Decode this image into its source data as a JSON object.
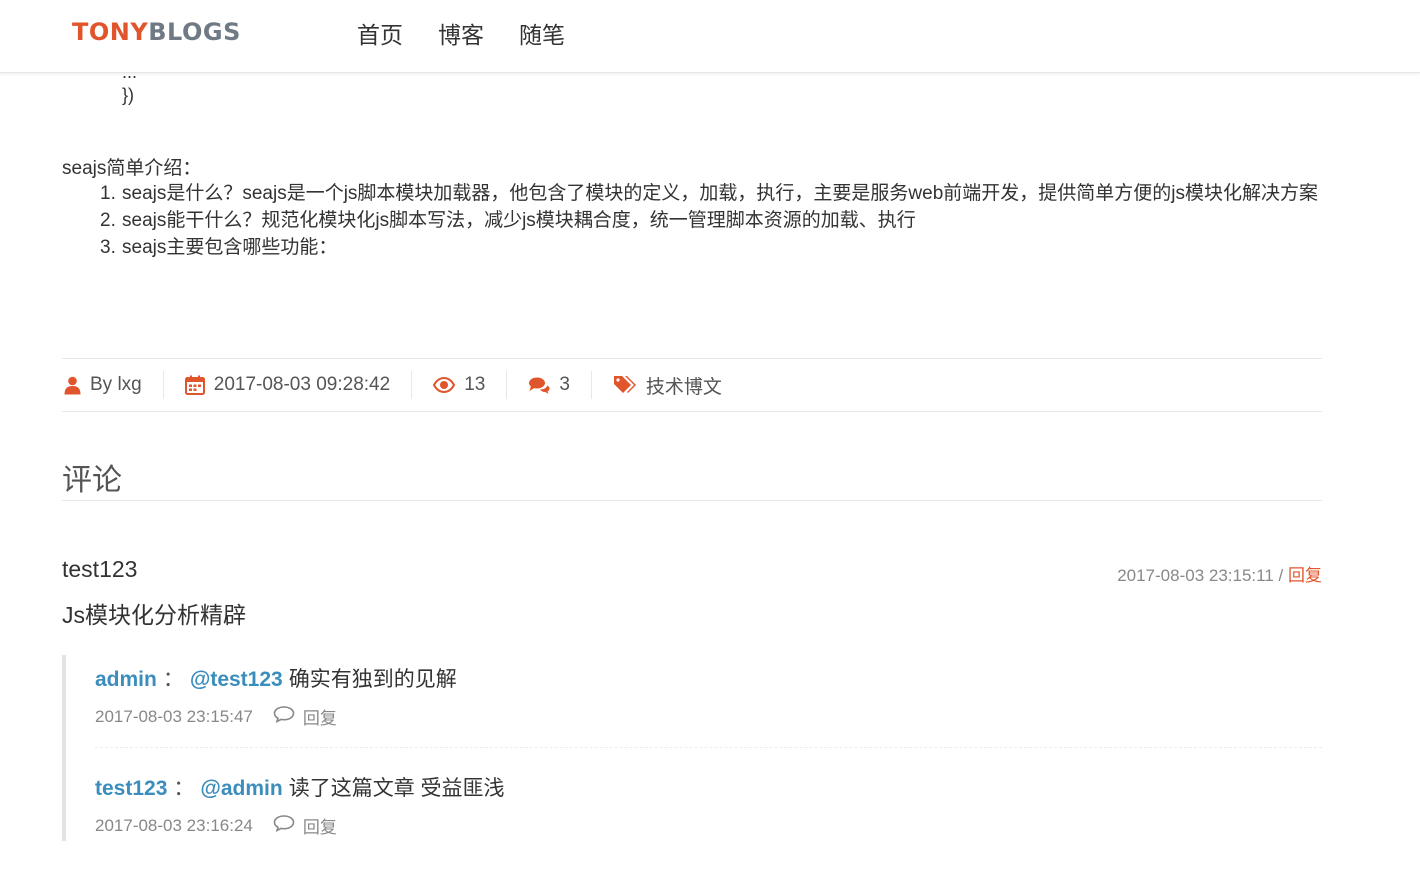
{
  "header": {
    "logo_part1": "TONY",
    "logo_part2": "BLOGS",
    "nav": [
      "首页",
      "博客",
      "随笔"
    ]
  },
  "article": {
    "code_lines": [
      "...",
      "})"
    ],
    "intro_title": "seajs简单介绍：",
    "intro_items": [
      {
        "num": "1.",
        "text": "seajs是什么？seajs是一个js脚本模块加载器，他包含了模块的定义，加载，执行，主要是服务web前端开发，提供简单方便的js模块化解决方案"
      },
      {
        "num": "2.",
        "text": "seajs能干什么？规范化模块化js脚本写法，减少js模块耦合度，统一管理脚本资源的加载、执行"
      },
      {
        "num": "3.",
        "text": "seajs主要包含哪些功能："
      }
    ]
  },
  "meta": {
    "author": "By lxg",
    "date": "2017-08-03 09:28:42",
    "views": "13",
    "comments": "3",
    "tag": "技术博文",
    "icons": [
      "user-icon",
      "calendar-icon",
      "eye-icon",
      "comments-icon",
      "tags-icon"
    ],
    "accent_color": "#e0552b"
  },
  "comments": {
    "heading": "评论",
    "items": [
      {
        "author": "test123",
        "time": "2017-08-03 23:15:11",
        "separator": "/",
        "reply_label": "回复",
        "body": "Js模块化分析精辟",
        "replies": [
          {
            "who": "admin",
            "colon": "：",
            "mention": "@test123",
            "text": "确实有独到的见解",
            "time": "2017-08-03 23:15:47",
            "reply_label": "回复"
          },
          {
            "who": "test123",
            "colon": "：",
            "mention": "@admin",
            "text": "读了这篇文章 受益匪浅",
            "time": "2017-08-03 23:16:24",
            "reply_label": "回复"
          }
        ]
      }
    ]
  },
  "colors": {
    "link_blue": "#3b8dbd",
    "accent": "#e0552b"
  }
}
